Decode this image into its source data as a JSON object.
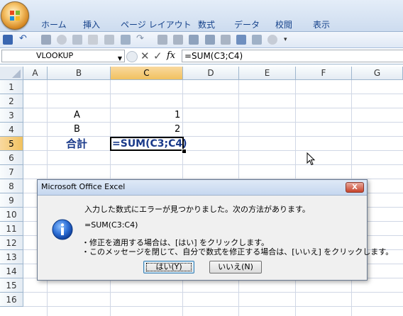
{
  "app": {
    "ribbon_tabs": [
      "ホーム",
      "挿入",
      "ページ レイアウト",
      "数式",
      "データ",
      "校閲",
      "表示"
    ],
    "accent_color": "#15428b"
  },
  "formula_bar": {
    "name_box": "VLOOKUP",
    "formula": "=SUM(C3;C4)",
    "cancel_icon": "x-icon",
    "enter_icon": "check-icon",
    "fx_label": "fx"
  },
  "sheet": {
    "columns": [
      "A",
      "B",
      "C",
      "D",
      "E",
      "F",
      "G"
    ],
    "selected_column": "C",
    "rows": [
      "1",
      "2",
      "3",
      "4",
      "5",
      "6",
      "7",
      "8",
      "9",
      "10",
      "11",
      "12",
      "13",
      "14",
      "15",
      "16"
    ],
    "selected_row": "5",
    "cells": {
      "B3": "A",
      "C3": "1",
      "B4": "B",
      "C4": "2",
      "B5": "合計",
      "C5": "=SUM(C3;C4)"
    }
  },
  "dialog": {
    "title": "Microsoft Office Excel",
    "close_label": "X",
    "message_line1": "入力した数式にエラーが見つかりました。次の方法があります。",
    "formula_suggestion": "=SUM(C3:C4)",
    "bullet1": "・修正を適用する場合は、[はい] をクリックします。",
    "bullet2": "・このメッセージを閉じて、自分で数式を修正する場合は、[いいえ] をクリックします。",
    "yes_label": "はい(Y)",
    "no_label": "いいえ(N)",
    "icon": "info-icon"
  }
}
